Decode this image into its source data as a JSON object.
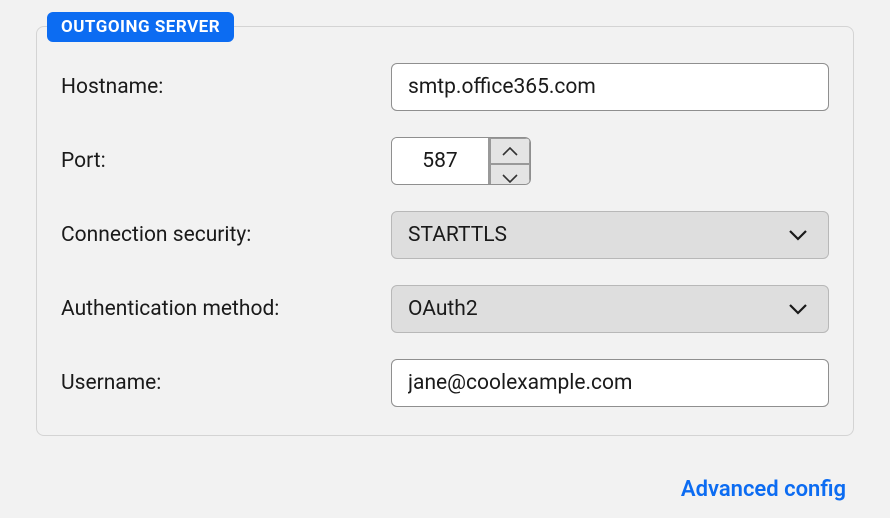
{
  "fieldset": {
    "badge": "OUTGOING SERVER",
    "hostname": {
      "label": "Hostname:",
      "value": "smtp.office365.com"
    },
    "port": {
      "label": "Port:",
      "value": "587"
    },
    "connection_security": {
      "label": "Connection security:",
      "value": "STARTTLS"
    },
    "auth_method": {
      "label": "Authentication method:",
      "value": "OAuth2"
    },
    "username": {
      "label": "Username:",
      "value": "jane@coolexample.com"
    }
  },
  "advanced_link": "Advanced config"
}
